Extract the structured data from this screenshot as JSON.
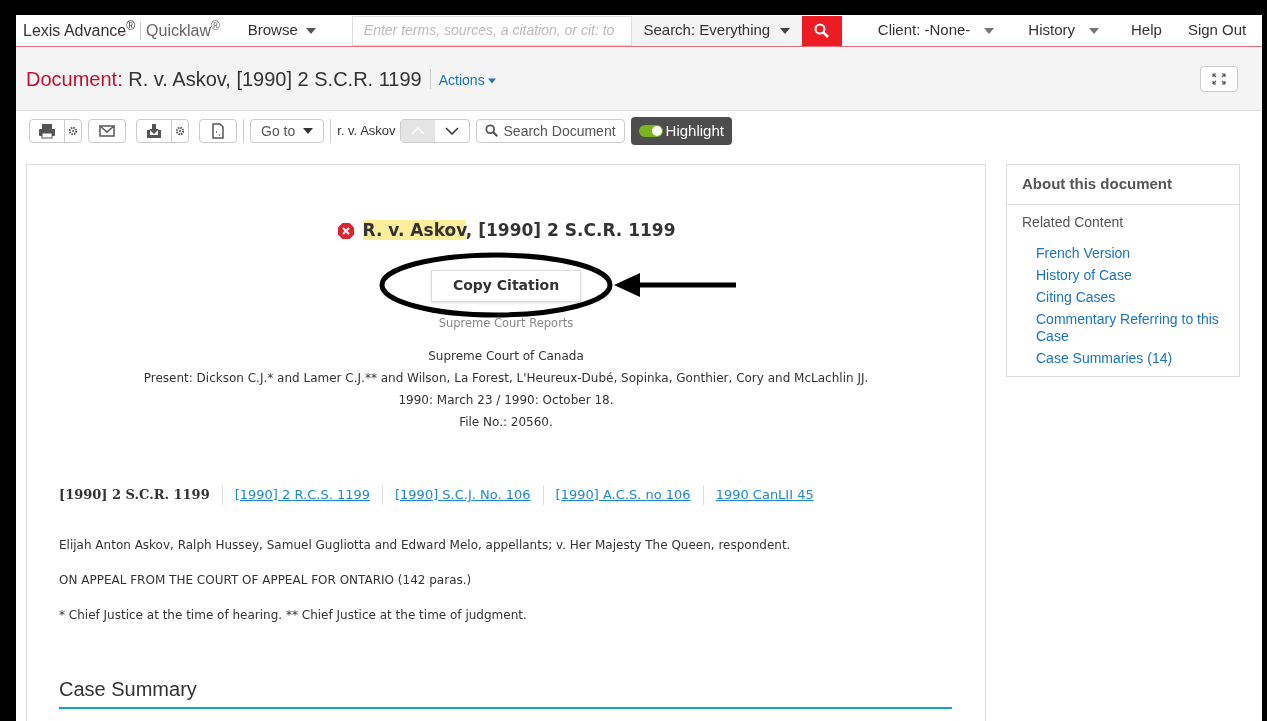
{
  "header": {
    "brand": "Lexis Advance$^{®}$",
    "product": "Quicklaw$^{®}$",
    "browse": "Browse",
    "search_placeholder": "Enter terms, sources, a citation, or cit: to",
    "search_scope": "Search: Everything",
    "client": "Client: -None-",
    "history": "History",
    "help": "Help",
    "sign_out": "Sign Out"
  },
  "document_bar": {
    "label": "Document:",
    "title": "R. v. Askov, [1990] 2 S.C.R. 1199",
    "actions": "Actions"
  },
  "toolbar": {
    "go_to": "Go to",
    "term": "r. v. Askov",
    "search_document": "Search Document",
    "highlight": {
      "label": "Highlight",
      "on": true
    }
  },
  "document": {
    "heading_highlight": "R. v. Askov",
    "heading_rest": ", [1990] 2 S.C.R. 1199",
    "copy_citation": "Copy Citation",
    "reporter": "Supreme Court Reports",
    "court_lines": [
      "Supreme Court of Canada",
      "Present: Dickson C.J.* and Lamer C.J.** and Wilson, La Forest, L'Heureux-Dubé, Sopinka, Gonthier, Cory and McLachlin JJ.",
      "1990: March 23 / 1990: October 18.",
      "File No.: 20560."
    ],
    "citations": [
      {
        "text": "[1990] 2 S.C.R. 1199",
        "kind": "current"
      },
      {
        "text": "[1990] 2 R.C.S. 1199",
        "kind": "link"
      },
      {
        "text": "[1990] S.C.J. No. 106",
        "kind": "link"
      },
      {
        "text": "[1990] A.C.S. no 106",
        "kind": "link"
      },
      {
        "text": "1990 CanLII 45",
        "kind": "link"
      }
    ],
    "paragraphs": [
      "Elijah Anton Askov, Ralph Hussey, Samuel Gugliotta and Edward Melo, appellants; v. Her Majesty The Queen, respondent.",
      "ON APPEAL FROM THE COURT OF APPEAL FOR ONTARIO (142 paras.)",
      "* Chief Justice at the time of hearing. ** Chief Justice at the time of judgment."
    ],
    "section_heading": "Case Summary"
  },
  "sidebar": {
    "title": "About this document",
    "subtitle": "Related Content",
    "links": [
      "French Version",
      "History of Case",
      "Citing Cases",
      "Commentary Referring to this Case",
      "Case Summaries (14)"
    ]
  }
}
